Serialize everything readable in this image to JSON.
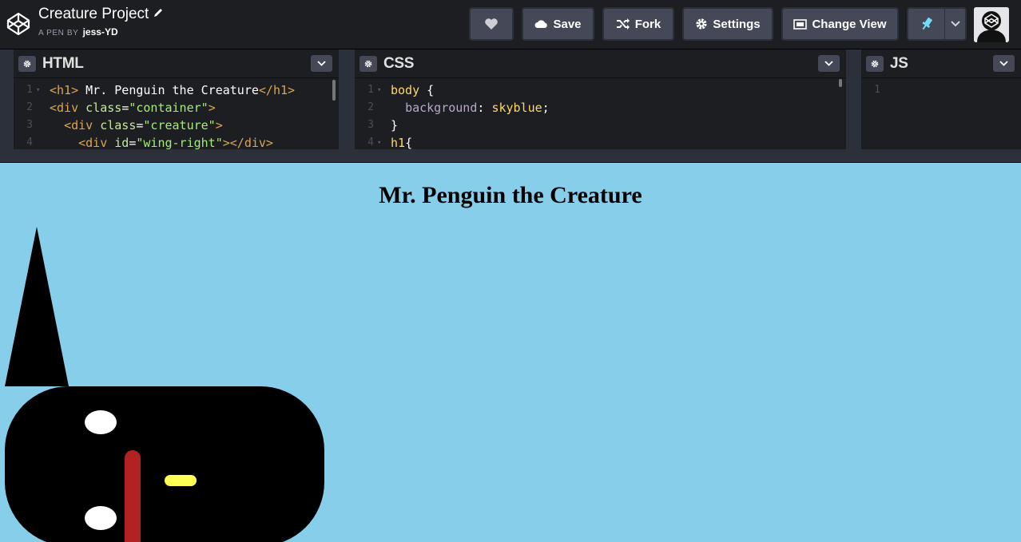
{
  "header": {
    "pen_title": "Creature Project",
    "pen_by_label": "A PEN BY",
    "author": "jess-YD",
    "buttons": {
      "heart_icon": "heart-icon",
      "save": "Save",
      "fork": "Fork",
      "settings": "Settings",
      "change_view": "Change View"
    }
  },
  "editors": {
    "html": {
      "title": "HTML",
      "lines": [
        {
          "n": "1",
          "parts": [
            [
              "t-tag",
              "<h1>"
            ],
            [
              "t-plain",
              " Mr. Penguin the Creature"
            ],
            [
              "t-tag",
              "</h1>"
            ]
          ]
        },
        {
          "n": "2",
          "parts": [
            [
              "t-tag",
              "<div "
            ],
            [
              "t-attr",
              "class"
            ],
            [
              "t-plain",
              "="
            ],
            [
              "t-str",
              "\"container\""
            ],
            [
              "t-tag",
              ">"
            ]
          ]
        },
        {
          "n": "3",
          "parts": [
            [
              "t-plain",
              "  "
            ],
            [
              "t-tag",
              "<div "
            ],
            [
              "t-attr",
              "class"
            ],
            [
              "t-plain",
              "="
            ],
            [
              "t-str",
              "\"creature\""
            ],
            [
              "t-tag",
              ">"
            ]
          ]
        },
        {
          "n": "4",
          "parts": [
            [
              "t-plain",
              "    "
            ],
            [
              "t-tag",
              "<div "
            ],
            [
              "t-attr",
              "id"
            ],
            [
              "t-plain",
              "="
            ],
            [
              "t-str",
              "\"wing-right\""
            ],
            [
              "t-tag",
              "></div>"
            ]
          ]
        }
      ]
    },
    "css": {
      "title": "CSS",
      "lines": [
        {
          "n": "1",
          "parts": [
            [
              "t-sel",
              "body"
            ],
            [
              "t-plain",
              " {"
            ]
          ]
        },
        {
          "n": "2",
          "parts": [
            [
              "t-plain",
              "  "
            ],
            [
              "t-prop",
              "background"
            ],
            [
              "t-plain",
              ": "
            ],
            [
              "t-val",
              "skyblue"
            ],
            [
              "t-plain",
              ";"
            ]
          ]
        },
        {
          "n": "3",
          "parts": [
            [
              "t-plain",
              "}"
            ]
          ]
        },
        {
          "n": "4",
          "parts": [
            [
              "t-sel",
              "h1"
            ],
            [
              "t-plain",
              "{"
            ]
          ]
        }
      ]
    },
    "js": {
      "title": "JS",
      "lines": [
        {
          "n": "1",
          "parts": []
        }
      ]
    }
  },
  "preview": {
    "heading": "Mr. Penguin the Creature",
    "background": "#87ceeb"
  }
}
